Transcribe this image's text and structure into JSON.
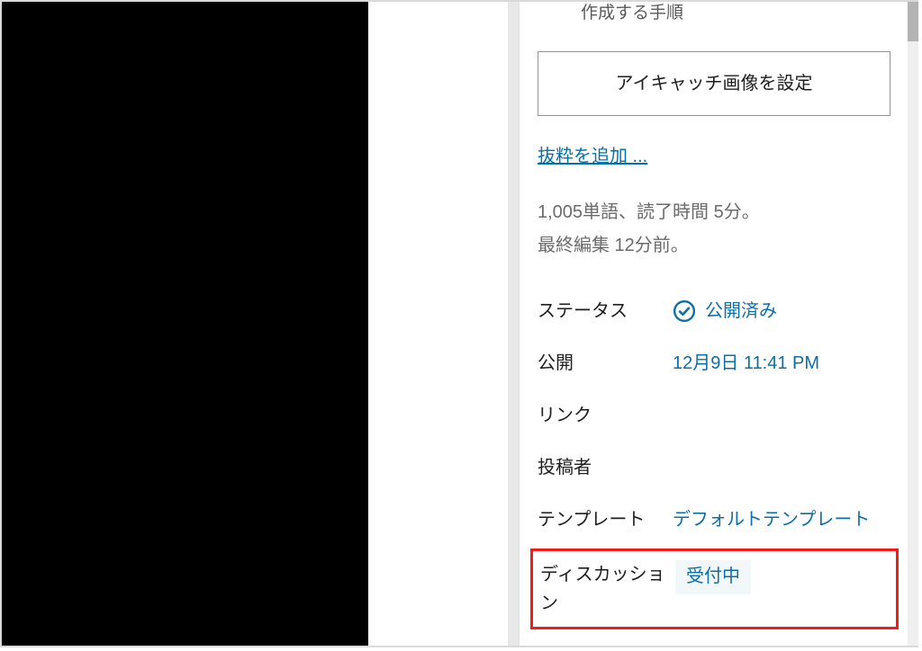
{
  "caption": "作成する手順",
  "featured_image_button": "アイキャッチ画像を設定",
  "excerpt_link": "抜粋を追加 ...",
  "stats": {
    "line1": "1,005単語、読了時間 5分。",
    "line2": "最終編集 12分前。"
  },
  "meta": {
    "status": {
      "label": "ステータス",
      "value": "公開済み"
    },
    "publish": {
      "label": "公開",
      "value": "12月9日 11:41 PM"
    },
    "link": {
      "label": "リンク",
      "value": ""
    },
    "author": {
      "label": "投稿者",
      "value": ""
    },
    "template": {
      "label": "テンプレート",
      "value": "デフォルトテンプレート"
    },
    "discussion": {
      "label": "ディスカッション",
      "value": "受付中"
    }
  }
}
